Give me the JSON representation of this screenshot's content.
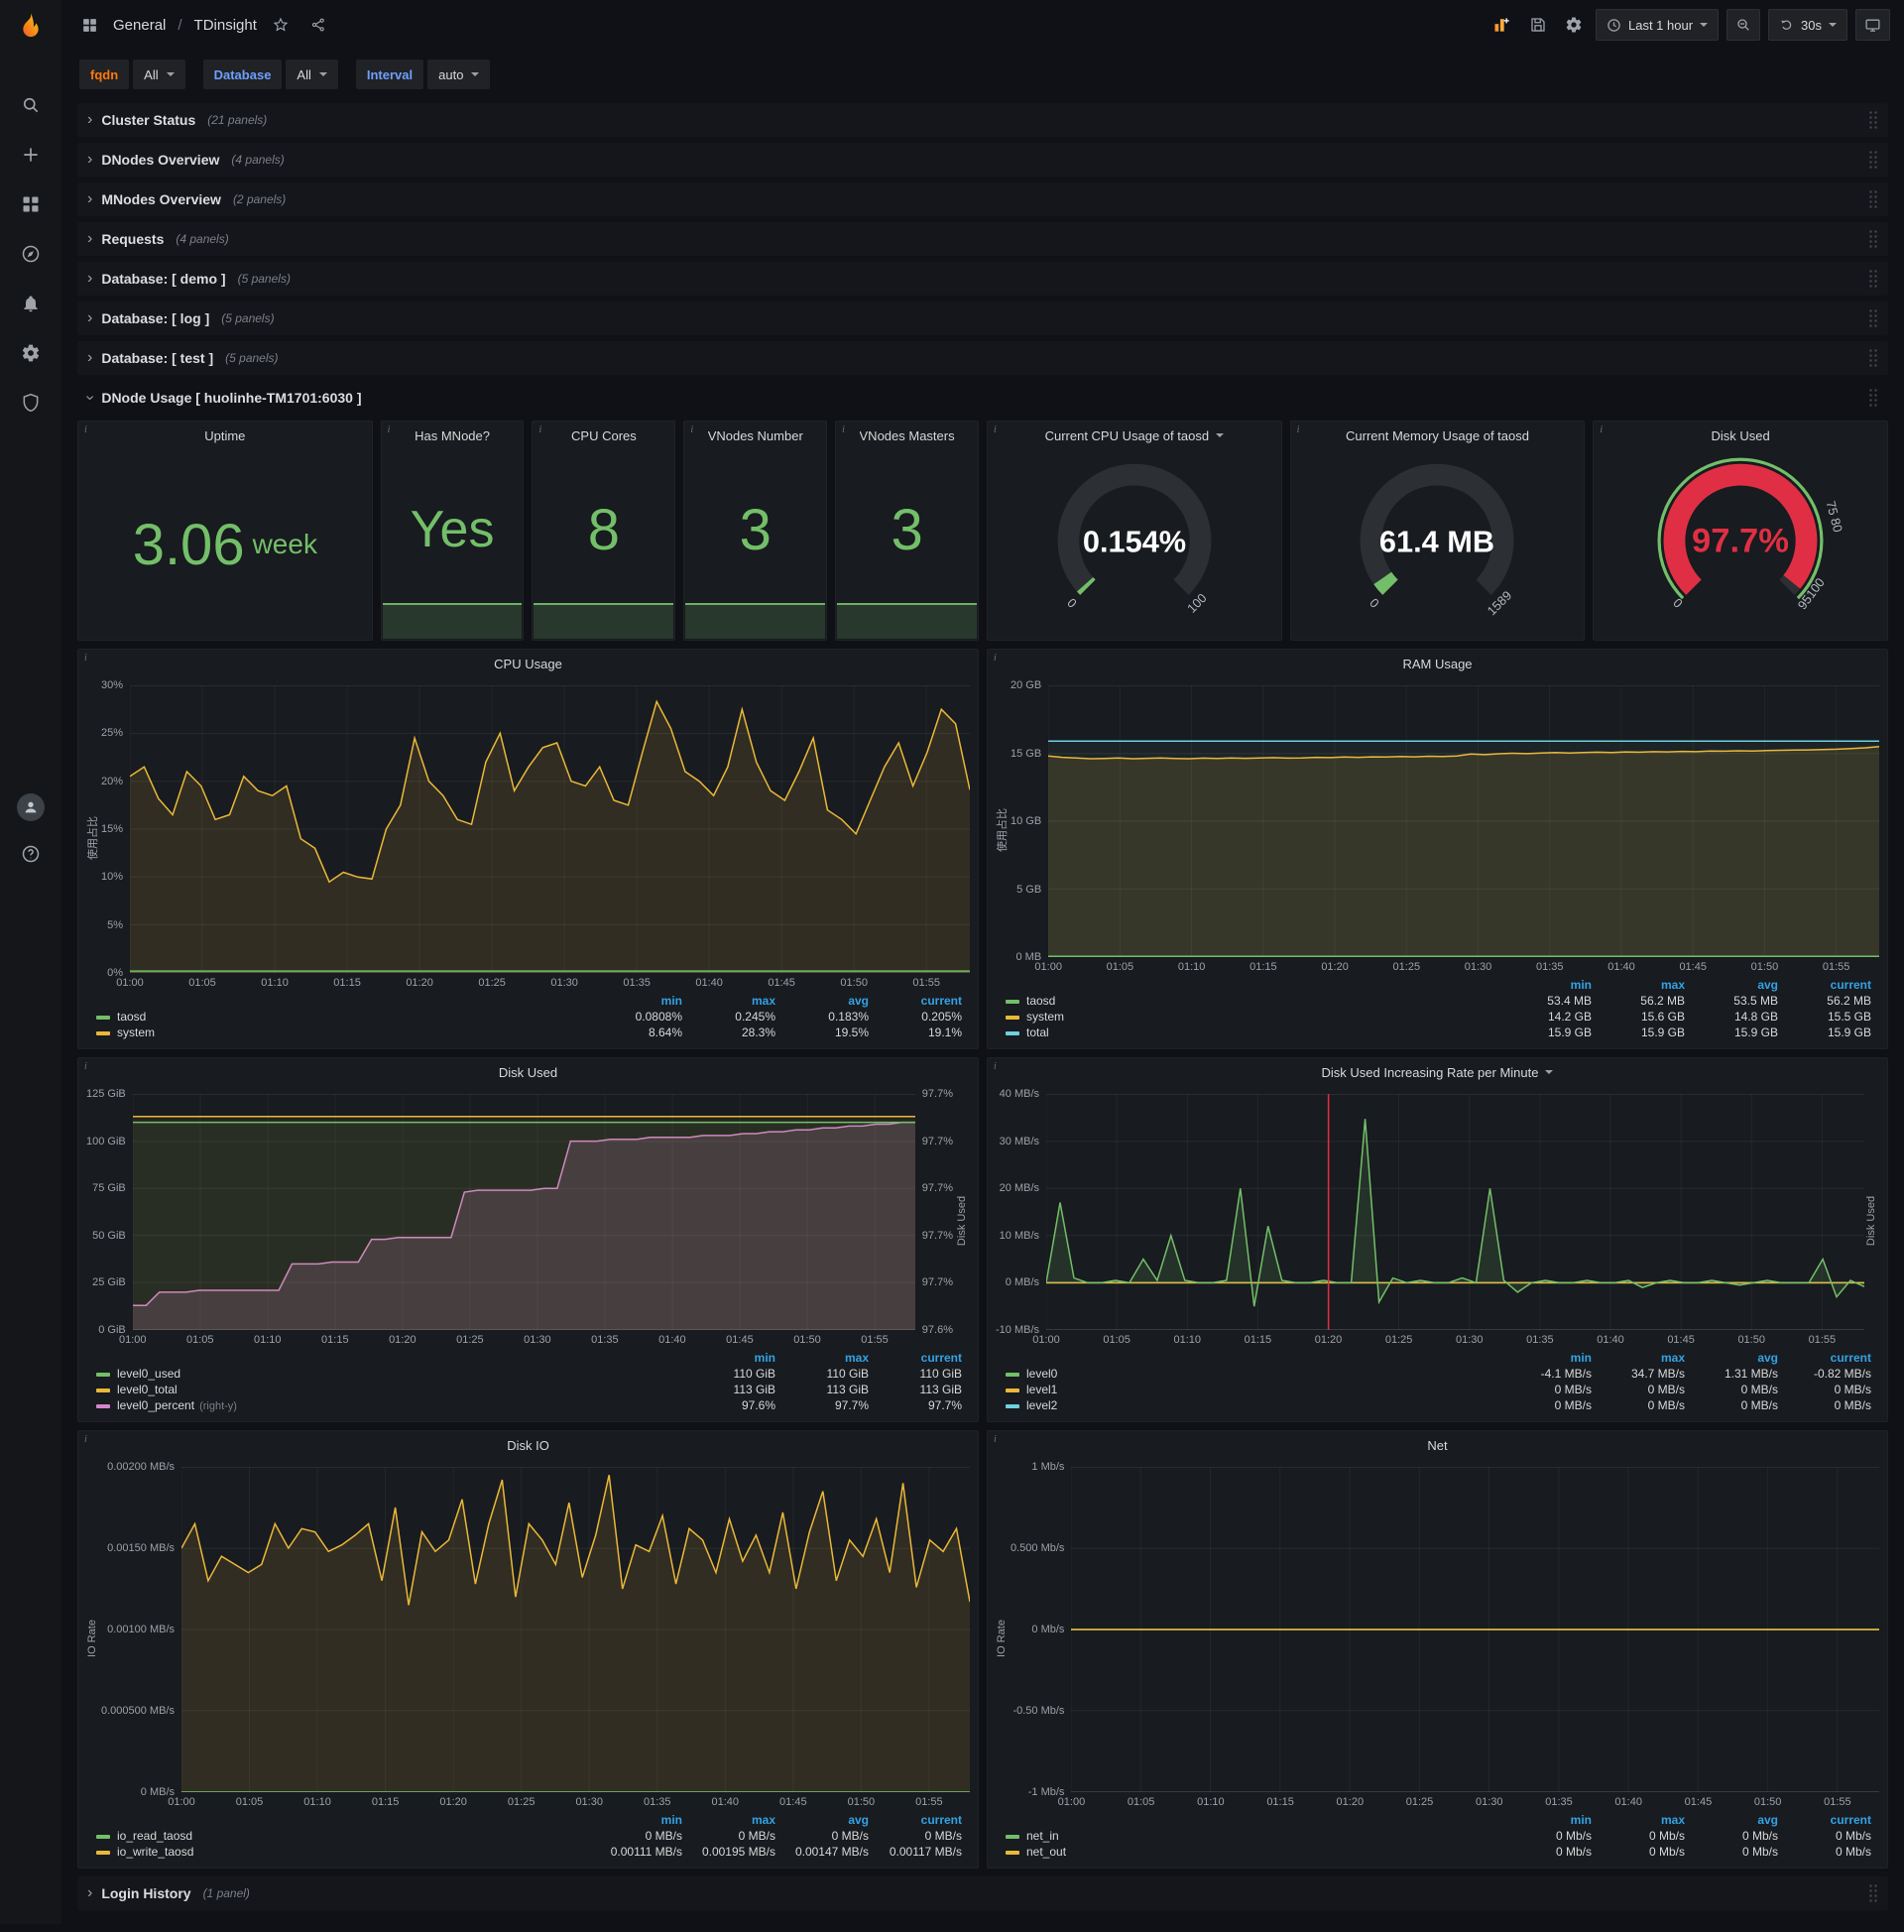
{
  "nav": {
    "section": "General",
    "sep": "/",
    "page": "TDinsight",
    "time_range": "Last 1 hour",
    "refresh_interval": "30s"
  },
  "variables": [
    {
      "label": "fqdn",
      "value": "All",
      "label_color": "#ff780a"
    },
    {
      "label": "Database",
      "value": "All",
      "label_color": "#6e9fff"
    },
    {
      "label": "Interval",
      "value": "auto",
      "label_color": "#6e9fff"
    }
  ],
  "rows": [
    {
      "title": "Cluster Status",
      "count": "(21 panels)"
    },
    {
      "title": "DNodes Overview",
      "count": "(4 panels)"
    },
    {
      "title": "MNodes Overview",
      "count": "(2 panels)"
    },
    {
      "title": "Requests",
      "count": "(4 panels)"
    },
    {
      "title": "Database: [ demo ]",
      "count": "(5 panels)"
    },
    {
      "title": "Database: [ log ]",
      "count": "(5 panels)"
    },
    {
      "title": "Database: [ test ]",
      "count": "(5 panels)"
    }
  ],
  "expanded_row": {
    "title": "DNode Usage [ huolinhe-TM1701:6030 ]"
  },
  "bottom_row": {
    "title": "Login History",
    "count": "(1 panel)"
  },
  "stats": {
    "uptime": {
      "title": "Uptime",
      "value": "3.06",
      "suffix": "week"
    },
    "has_mnode": {
      "title": "Has MNode?",
      "value": "Yes"
    },
    "cpu_cores": {
      "title": "CPU Cores",
      "value": "8"
    },
    "vnodes_number": {
      "title": "VNodes Number",
      "value": "3"
    },
    "vnodes_masters": {
      "title": "VNodes Masters",
      "value": "3"
    }
  },
  "gauges": {
    "cpu": {
      "title": "Current CPU Usage of taosd",
      "value": "0.154%",
      "percent": 0.154,
      "color": "#73bf69",
      "ticks": [
        {
          "label": "0",
          "pct": 0
        },
        {
          "label": "100",
          "pct": 1
        }
      ]
    },
    "mem": {
      "title": "Current Memory Usage of taosd",
      "value": "61.4 MB",
      "percent": 3.86,
      "color": "#73bf69",
      "ticks": [
        {
          "label": "0",
          "pct": 0
        },
        {
          "label": "1589",
          "pct": 1
        }
      ]
    },
    "disk": {
      "title": "Disk Used",
      "value": "97.7%",
      "percent": 97.7,
      "color": "#e02f44",
      "value_color": "#e02f44",
      "outer_color": "#73bf69",
      "ticks": [
        {
          "label": "0",
          "pct": 0
        },
        {
          "label": "75 80",
          "pct": 0.78
        },
        {
          "label": "95100",
          "pct": 0.97
        }
      ]
    }
  },
  "time_ticks": [
    "01:00",
    "01:05",
    "01:10",
    "01:15",
    "01:20",
    "01:25",
    "01:30",
    "01:35",
    "01:40",
    "01:45",
    "01:50",
    "01:55"
  ],
  "chart_data": {
    "cpu_usage": {
      "type": "line",
      "title": "CPU Usage",
      "ylabel": "使用占比",
      "yticks": [
        "30%",
        "25%",
        "20%",
        "15%",
        "10%",
        "5%",
        "0%"
      ],
      "ymin": 0,
      "ymax": 30,
      "legend_headers": [
        "min",
        "max",
        "avg",
        "current"
      ],
      "series": [
        {
          "name": "taosd",
          "color": "#73bf69",
          "legend": [
            "0.0808%",
            "0.245%",
            "0.183%",
            "0.205%"
          ],
          "fill": 0.05,
          "values": {
            "const": 0.2,
            "n": 60
          }
        },
        {
          "name": "system",
          "color": "#eab839",
          "legend": [
            "8.64%",
            "28.3%",
            "19.5%",
            "19.1%"
          ],
          "fill": 0.12,
          "values": [
            20.5,
            21.5,
            18.2,
            16.5,
            21.0,
            19.5,
            16.0,
            16.5,
            20.5,
            19.0,
            18.5,
            19.5,
            14.0,
            13.0,
            9.5,
            10.5,
            10.0,
            9.8,
            15.0,
            17.5,
            24.5,
            20.0,
            18.5,
            16.0,
            15.5,
            22.0,
            25.0,
            19.0,
            21.5,
            23.5,
            24.0,
            20.0,
            19.5,
            21.5,
            18.0,
            17.5,
            23.0,
            28.3,
            25.5,
            21.0,
            20.0,
            18.5,
            21.5,
            27.5,
            22.0,
            19.0,
            18.0,
            21.0,
            24.5,
            17.0,
            16.0,
            14.5,
            18.0,
            21.5,
            24.0,
            19.5,
            23.0,
            27.5,
            26.0,
            19.1
          ]
        }
      ]
    },
    "ram_usage": {
      "type": "line",
      "title": "RAM Usage",
      "ylabel": "使用占比",
      "yticks": [
        "20 GB",
        "15 GB",
        "10 GB",
        "5 GB",
        "0 MB"
      ],
      "ymin": 0,
      "ymax": 20,
      "legend_headers": [
        "min",
        "max",
        "avg",
        "current"
      ],
      "series": [
        {
          "name": "taosd",
          "color": "#73bf69",
          "legend": [
            "53.4 MB",
            "56.2 MB",
            "53.5 MB",
            "56.2 MB"
          ],
          "values": {
            "const": 0.054,
            "n": 60
          }
        },
        {
          "name": "system",
          "color": "#eab839",
          "legend": [
            "14.2 GB",
            "15.6 GB",
            "14.8 GB",
            "15.5 GB"
          ],
          "fill": 0.13,
          "values": [
            14.8,
            14.7,
            14.65,
            14.6,
            14.62,
            14.65,
            14.6,
            14.63,
            14.66,
            14.62,
            14.6,
            14.64,
            14.62,
            14.66,
            14.63,
            14.65,
            14.68,
            14.64,
            14.66,
            14.7,
            14.68,
            14.72,
            14.7,
            14.74,
            14.72,
            14.76,
            14.74,
            14.78,
            14.76,
            14.8,
            14.95,
            14.9,
            14.96,
            15.0,
            14.97,
            15.02,
            15.05,
            15.02,
            15.06,
            15.08,
            15.06,
            15.1,
            15.08,
            15.12,
            15.1,
            15.14,
            15.12,
            15.16,
            15.15,
            15.18,
            15.16,
            15.2,
            15.22,
            15.24,
            15.25,
            15.28,
            15.3,
            15.35,
            15.4,
            15.5
          ]
        },
        {
          "name": "total",
          "color": "#6ed0e0",
          "legend": [
            "15.9 GB",
            "15.9 GB",
            "15.9 GB",
            "15.9 GB"
          ],
          "fill": 0.05,
          "values": {
            "const": 15.9,
            "n": 60
          }
        }
      ]
    },
    "disk_used": {
      "type": "line",
      "title": "Disk Used",
      "yticks": [
        "125 GiB",
        "100 GiB",
        "75 GiB",
        "50 GiB",
        "25 GiB",
        "0 GiB"
      ],
      "yticks_right": [
        "97.7%",
        "97.7%",
        "97.7%",
        "97.7%",
        "97.7%",
        "97.6%"
      ],
      "ylabel_right": "Disk Used",
      "ymin": 0,
      "ymax": 125,
      "legend_headers": [
        "min",
        "max",
        "current"
      ],
      "series": [
        {
          "name": "level0_used",
          "color": "#73bf69",
          "legend": [
            "110 GiB",
            "110 GiB",
            "110 GiB"
          ],
          "fill": 0.07,
          "values": {
            "const": 110,
            "n": 60
          }
        },
        {
          "name": "level0_total",
          "color": "#eab839",
          "legend": [
            "113 GiB",
            "113 GiB",
            "113 GiB"
          ],
          "fill": 0.06,
          "values": {
            "const": 113,
            "n": 60
          }
        },
        {
          "name": "level0_percent",
          "suffix": "(right-y)",
          "color": "#d683ce",
          "legend": [
            "97.6%",
            "97.7%",
            "97.7%"
          ],
          "fill": 0.18,
          "values": [
            13,
            13,
            20,
            20,
            20,
            21,
            21,
            21,
            21,
            21,
            21,
            21,
            35,
            35,
            35,
            36,
            36,
            36,
            48,
            48,
            49,
            49,
            49,
            49,
            49,
            73,
            74,
            74,
            74,
            74,
            74,
            75,
            75,
            100,
            100,
            100,
            101,
            101,
            101,
            102,
            102,
            102,
            102,
            103,
            103,
            103,
            104,
            104,
            105,
            105,
            106,
            106,
            107,
            107,
            108,
            108,
            109,
            109,
            110,
            110
          ]
        }
      ]
    },
    "disk_rate": {
      "type": "line",
      "title": "Disk Used Increasing Rate per Minute",
      "ylabel_right": "Disk Used",
      "yticks": [
        "40 MB/s",
        "30 MB/s",
        "20 MB/s",
        "10 MB/s",
        "0 MB/s",
        "-10 MB/s"
      ],
      "ymin": -10,
      "ymax": 40,
      "annotation_frac": 0.345,
      "legend_headers": [
        "min",
        "max",
        "avg",
        "current"
      ],
      "series": [
        {
          "name": "level0",
          "color": "#73bf69",
          "legend": [
            "-4.1 MB/s",
            "34.7 MB/s",
            "1.31 MB/s",
            "-0.82 MB/s"
          ],
          "fill": 0.15,
          "values": [
            0,
            17,
            1,
            0,
            0,
            0.5,
            0,
            5,
            0.5,
            10,
            0.5,
            0,
            0,
            0.5,
            20,
            -5,
            12,
            0.5,
            0,
            0,
            0.5,
            0,
            0,
            34.7,
            -4.1,
            1,
            0,
            0.5,
            0,
            0,
            1,
            0,
            20,
            0.5,
            -2,
            0,
            0.5,
            0,
            0,
            0.5,
            0,
            0,
            0.5,
            -1,
            0,
            0.5,
            0,
            0,
            0.5,
            0,
            -0.5,
            0,
            0.5,
            0,
            0,
            0,
            5,
            -3,
            0.5,
            -0.82
          ]
        },
        {
          "name": "level1",
          "color": "#eab839",
          "legend": [
            "0 MB/s",
            "0 MB/s",
            "0 MB/s",
            "0 MB/s"
          ],
          "values": {
            "const": 0,
            "n": 60
          }
        },
        {
          "name": "level2",
          "color": "#6ed0e0",
          "legend": [
            "0 MB/s",
            "0 MB/s",
            "0 MB/s",
            "0 MB/s"
          ],
          "values": {
            "const": 0,
            "n": 60
          }
        }
      ]
    },
    "disk_io": {
      "type": "line",
      "title": "Disk IO",
      "ylabel": "IO Rate",
      "yticks": [
        "0.00200 MB/s",
        "0.00150 MB/s",
        "0.00100 MB/s",
        "0.000500 MB/s",
        "0 MB/s"
      ],
      "ymin": 0,
      "ymax": 0.002,
      "legend_headers": [
        "min",
        "max",
        "avg",
        "current"
      ],
      "series": [
        {
          "name": "io_read_taosd",
          "color": "#73bf69",
          "legend": [
            "0 MB/s",
            "0 MB/s",
            "0 MB/s",
            "0 MB/s"
          ],
          "values": {
            "const": 0,
            "n": 60
          }
        },
        {
          "name": "io_write_taosd",
          "color": "#eab839",
          "legend": [
            "0.00111 MB/s",
            "0.00195 MB/s",
            "0.00147 MB/s",
            "0.00117 MB/s"
          ],
          "fill": 0.12,
          "values": [
            0.0015,
            0.00165,
            0.0013,
            0.00145,
            0.0014,
            0.00135,
            0.0014,
            0.00165,
            0.0015,
            0.00162,
            0.0016,
            0.00148,
            0.00152,
            0.00158,
            0.00165,
            0.0013,
            0.00175,
            0.00115,
            0.0016,
            0.00148,
            0.00155,
            0.0018,
            0.00128,
            0.00165,
            0.00192,
            0.0012,
            0.00165,
            0.00155,
            0.0014,
            0.00178,
            0.00132,
            0.00158,
            0.00195,
            0.00125,
            0.00152,
            0.00148,
            0.0017,
            0.00128,
            0.00162,
            0.00155,
            0.00135,
            0.00168,
            0.00142,
            0.00158,
            0.00135,
            0.00172,
            0.00125,
            0.0016,
            0.00185,
            0.0013,
            0.00155,
            0.00145,
            0.00168,
            0.00135,
            0.0019,
            0.00126,
            0.00155,
            0.00148,
            0.00162,
            0.00117
          ]
        }
      ]
    },
    "net": {
      "type": "line",
      "title": "Net",
      "ylabel": "IO Rate",
      "yticks": [
        "1 Mb/s",
        "0.500 Mb/s",
        "0 Mb/s",
        "-0.50 Mb/s",
        "-1 Mb/s"
      ],
      "ymin": -1,
      "ymax": 1,
      "draw_order": "as-is",
      "legend_headers": [
        "min",
        "max",
        "avg",
        "current"
      ],
      "series": [
        {
          "name": "net_in",
          "color": "#73bf69",
          "legend": [
            "0 Mb/s",
            "0 Mb/s",
            "0 Mb/s",
            "0 Mb/s"
          ],
          "values": {
            "const": 0,
            "n": 60
          }
        },
        {
          "name": "net_out",
          "color": "#eab839",
          "legend": [
            "0 Mb/s",
            "0 Mb/s",
            "0 Mb/s",
            "0 Mb/s"
          ],
          "values": {
            "const": 0,
            "n": 60
          }
        }
      ]
    }
  }
}
